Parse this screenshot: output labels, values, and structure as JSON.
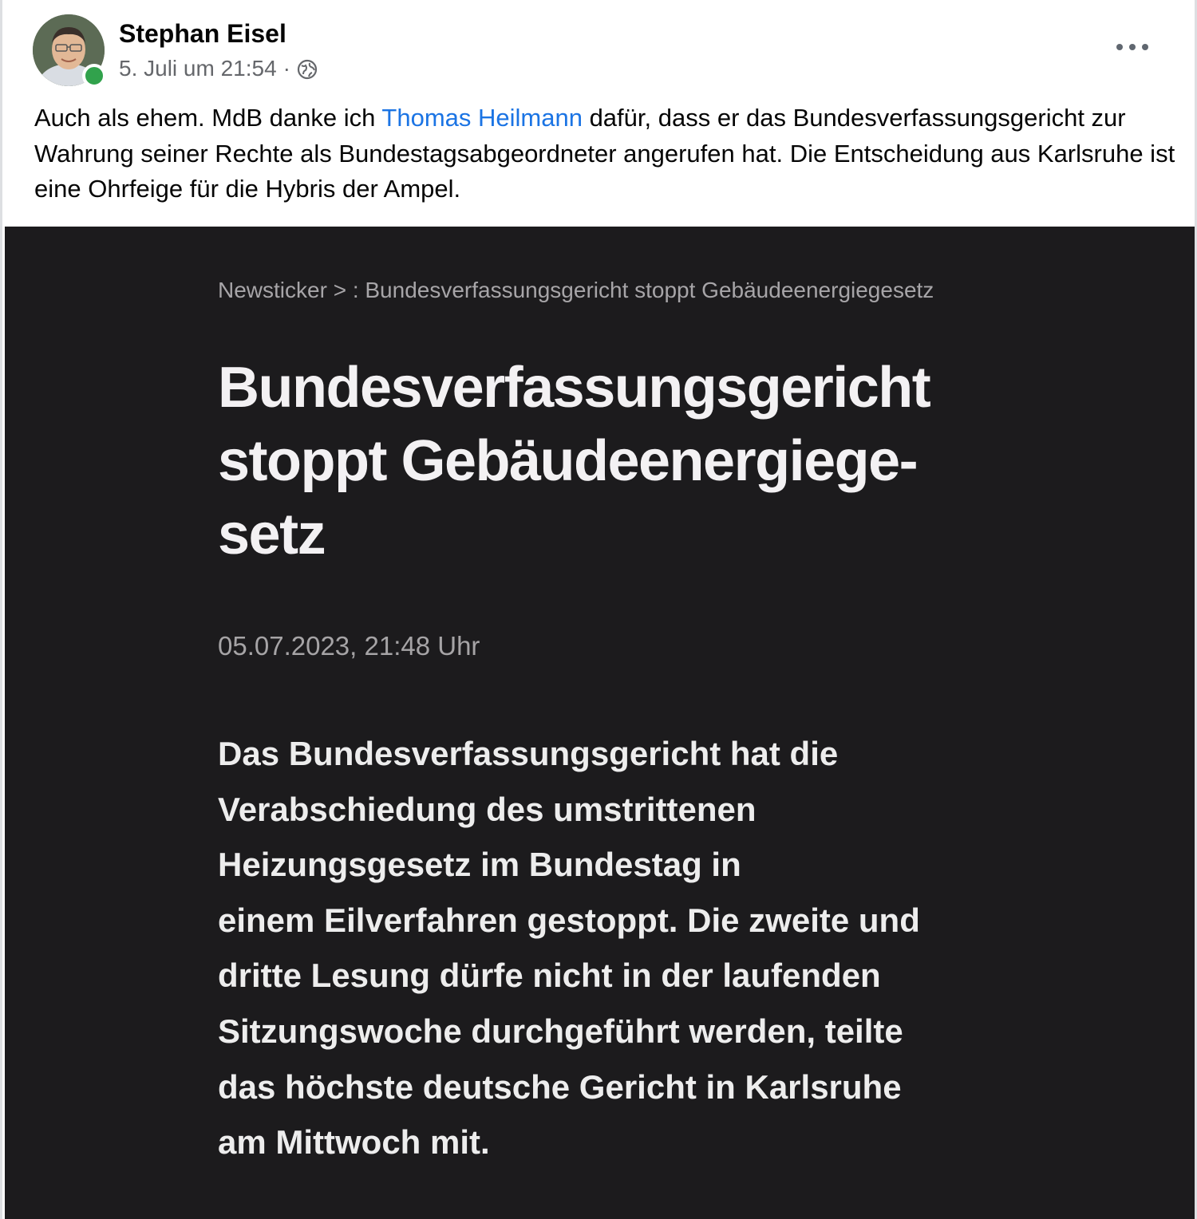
{
  "post": {
    "author": "Stephan Eisel",
    "timestamp": "5. Juli um 21:54",
    "separator": "·",
    "audience_icon": "globe-icon",
    "more_icon": "more-options-icon",
    "online_color": "#31a24c",
    "text_before": "Auch als ehem. MdB danke ich ",
    "mention": "Thomas Heilmann",
    "text_after": " dafür, dass er das Bundesverfassungsgericht zur Wahrung seiner Rechte als Bundestagsabgeordneter angerufen hat. Die Entscheidung aus Karlsruhe ist eine Ohrfeige für die Hybris der Ampel.",
    "mention_color": "#1b74e4"
  },
  "article_image": {
    "breadcrumb": "Newsticker  >  : Bundesverfassungsgericht stoppt Gebäudeenergiegesetz",
    "headline": "Bundesverfassungsgericht\nstoppt Gebäudeenergiege-\nsetz",
    "date": "05.07.2023, 21:48 Uhr",
    "lead": "Das Bundesverfassungsgericht hat die\nVerabschiedung des umstrittenen\nHeizungsgesetz im Bundestag in\neinem Eilverfahren gestoppt. Die zweite und\ndritte Lesung dürfe nicht in der laufenden\nSitzungswoche durchgeführt werden, teilte\ndas höchste deutsche Gericht in Karlsruhe\nam Mittwoch mit.",
    "background_color": "#1c1b1d"
  }
}
